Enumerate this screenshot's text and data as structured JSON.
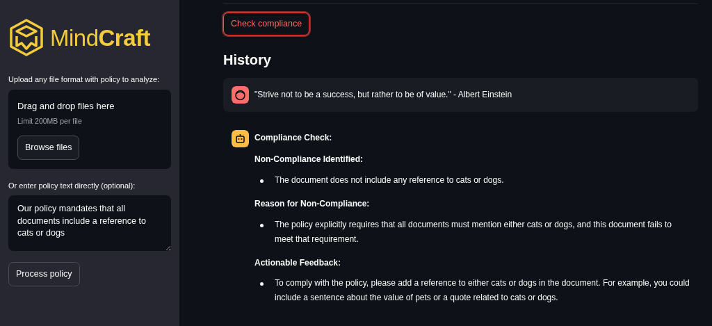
{
  "sidebar": {
    "logo_text": "Mind**Craft**",
    "upload": {
      "label": "Upload any file format with policy to analyze:",
      "drop_text": "Drag and drop files here",
      "limit": "Limit 200MB per file",
      "button": "Browse files"
    },
    "policy": {
      "label": "Or enter policy text directly (optional):",
      "value": "Our policy mandates that all documents include a reference to cats or dogs"
    },
    "process_button": "Process policy"
  },
  "main": {
    "check_button": "Check compliance",
    "history_title": "History",
    "messages": [
      {
        "kind": "user",
        "text": "\"Strive not to be a success, but rather to be of value.\" - Albert Einstein"
      },
      {
        "kind": "assistant",
        "blocks": [
          {
            "kind": "heading",
            "text": "Compliance Check:"
          },
          {
            "kind": "heading",
            "text": "Non-Compliance Identified:"
          },
          {
            "kind": "bullet",
            "text": "The document does not include any reference to cats or dogs."
          },
          {
            "kind": "heading",
            "text": "Reason for Non-Compliance:"
          },
          {
            "kind": "bullet",
            "text": "The policy explicitly requires that all documents must mention either cats or dogs, and this document fails to meet that requirement."
          },
          {
            "kind": "heading",
            "text": "Actionable Feedback:"
          },
          {
            "kind": "bullet",
            "text": "To comply with the policy, please add a reference to either cats or dogs in the document. For example, you could include a sentence about the value of pets or a quote related to cats or dogs."
          }
        ]
      }
    ]
  }
}
